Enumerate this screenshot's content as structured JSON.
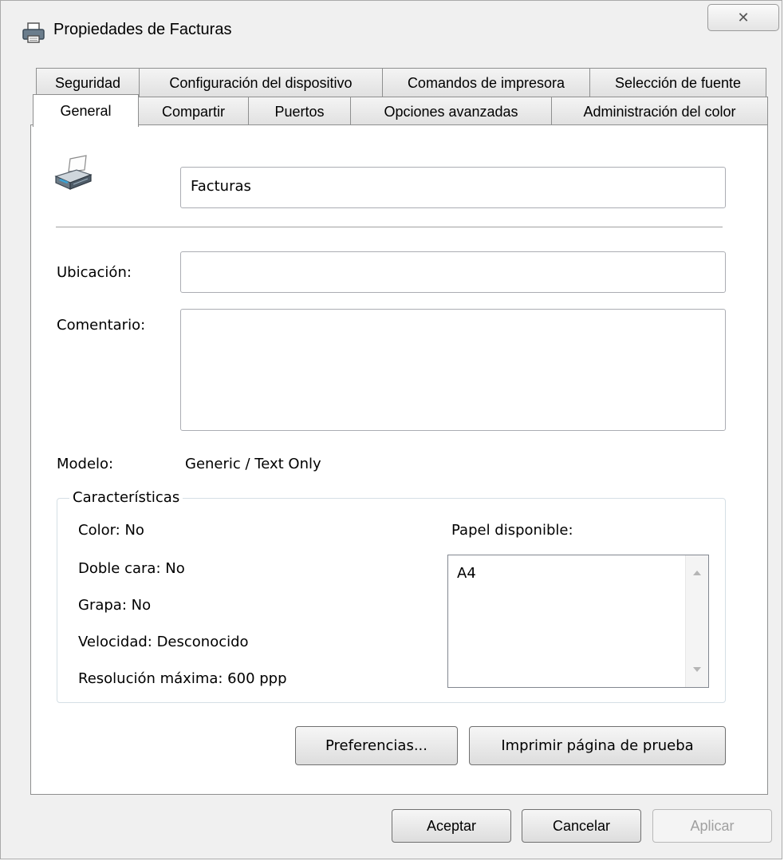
{
  "window": {
    "title": "Propiedades de Facturas",
    "close_glyph": "✕"
  },
  "tabs_row1": [
    "Seguridad",
    "Configuración del dispositivo",
    "Comandos de impresora",
    "Selección de fuente"
  ],
  "tabs_row2": [
    "General",
    "Compartir",
    "Puertos",
    "Opciones avanzadas",
    "Administración del color"
  ],
  "active_tab": "General",
  "general": {
    "printer_name": "Facturas",
    "location_label": "Ubicación:",
    "location_value": "",
    "comment_label": "Comentario:",
    "comment_value": "",
    "model_label": "Modelo:",
    "model_value": "Generic / Text Only",
    "features_title": "Características",
    "features": {
      "color": "Color: No",
      "duplex": "Doble cara: No",
      "staple": "Grapa: No",
      "speed": "Velocidad: Desconocido",
      "resolution": "Resolución máxima: 600 ppp"
    },
    "paper_label": "Papel disponible:",
    "paper_items": [
      "A4"
    ],
    "preferences_button": "Preferencias...",
    "test_page_button": "Imprimir página de prueba"
  },
  "footer": {
    "ok": "Aceptar",
    "cancel": "Cancelar",
    "apply": "Aplicar"
  },
  "icons": {
    "title": "printer-icon",
    "printer": "printer-icon",
    "scroll_up": "scroll-up-arrow-icon",
    "scroll_down": "scroll-down-arrow-icon",
    "close": "close-icon"
  }
}
